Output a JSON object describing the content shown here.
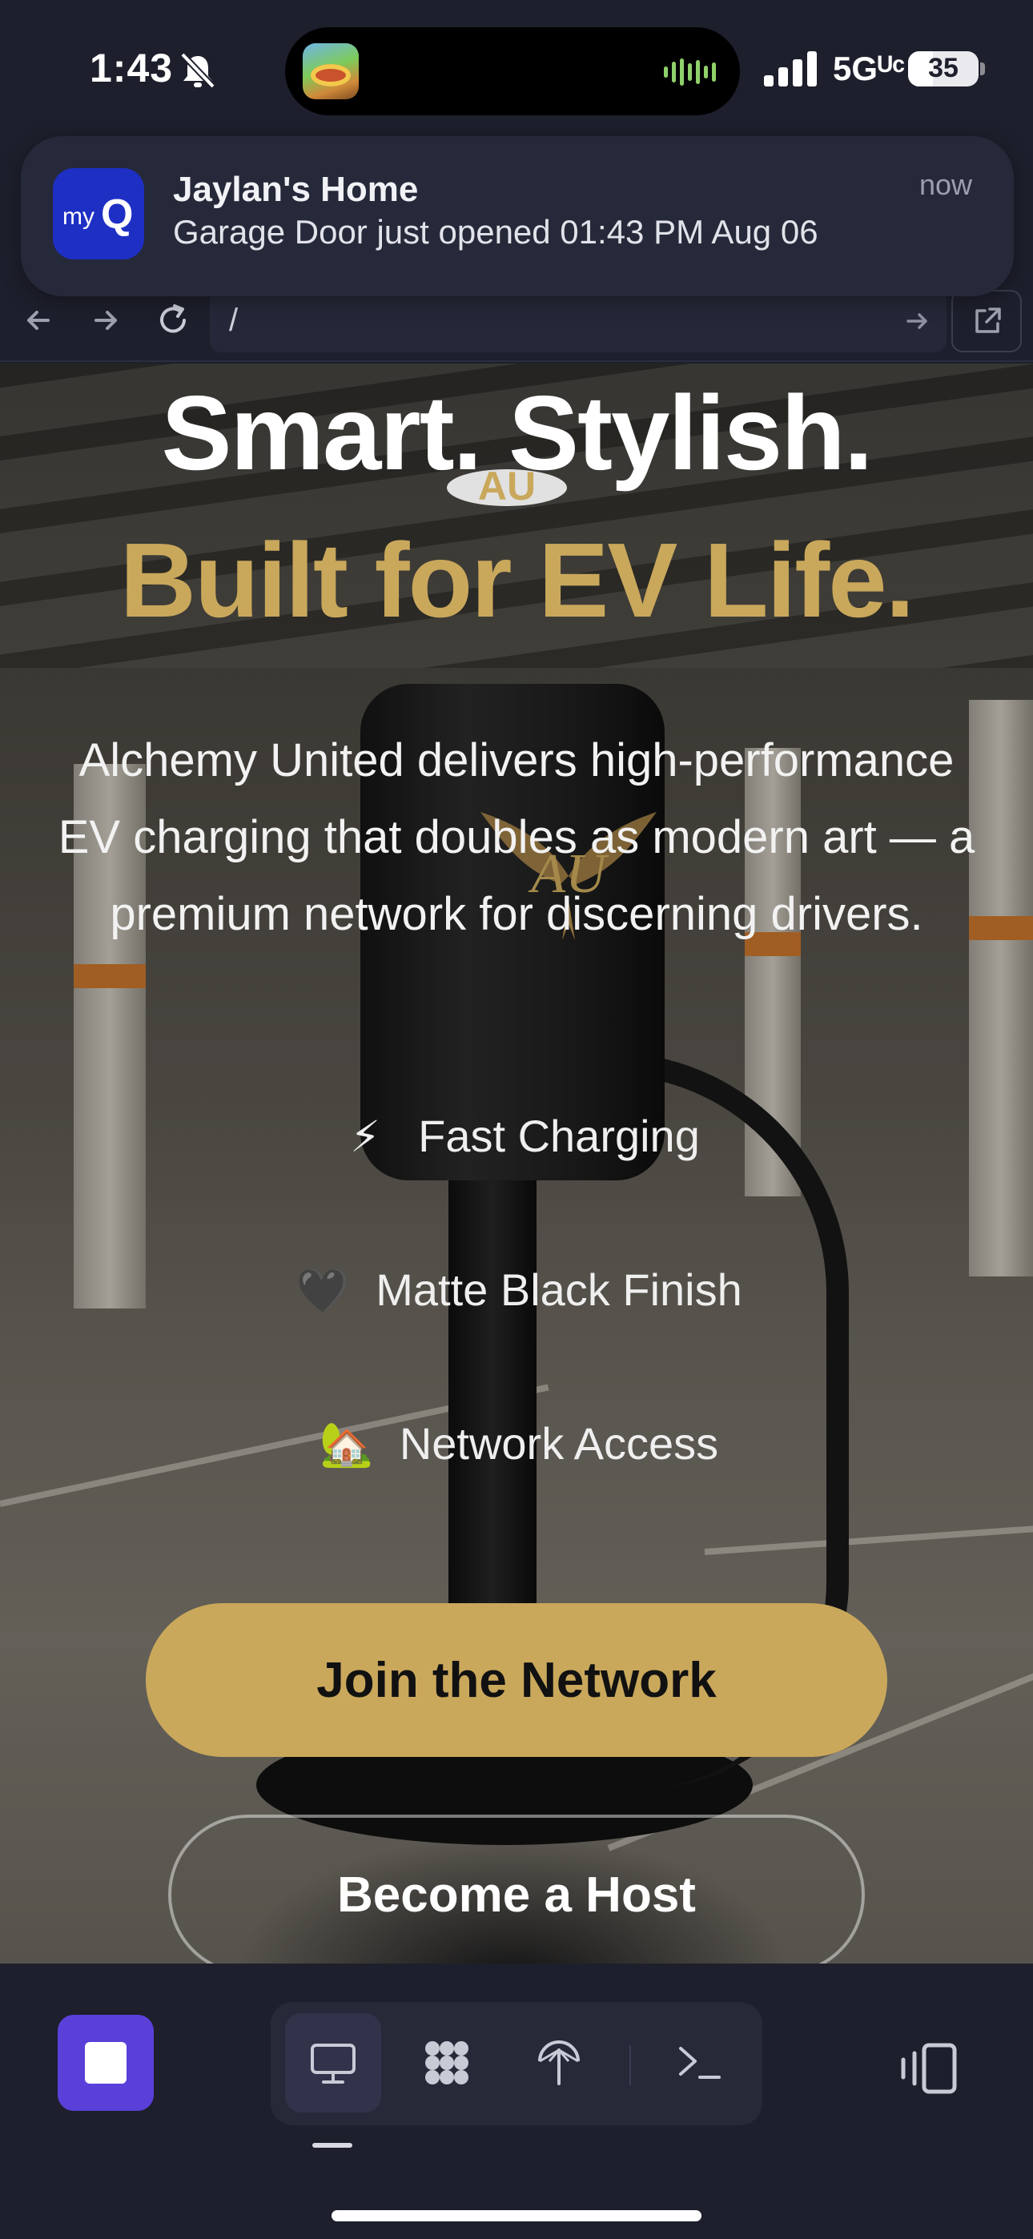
{
  "status_bar": {
    "time": "1:43",
    "network": "5Gᵁᶜ",
    "battery": "35",
    "battery_level": 0.35
  },
  "notification": {
    "app_icon_my": "my",
    "app_icon_q": "Q",
    "title": "Jaylan's Home",
    "body": "Garage Door just opened 01:43 PM Aug 06",
    "time": "now"
  },
  "browser": {
    "url": "/"
  },
  "hero": {
    "title_line1": "Smart. Stylish.",
    "badge": "AU",
    "title_line2": "Built for EV Life.",
    "description": "Alchemy United delivers high-performance EV charging that doubles as modern art — a premium network for discerning drivers.",
    "features": [
      {
        "emoji": "⚡",
        "icon": "lightning-icon",
        "label": "Fast Charging"
      },
      {
        "emoji": "🖤",
        "icon": "black-heart-icon",
        "label": "Matte Black Finish"
      },
      {
        "emoji": "🏡",
        "icon": "house-icon",
        "label": "Network Access"
      }
    ],
    "primary_button": "Join the Network",
    "secondary_button": "Become a Host"
  },
  "colors": {
    "accent_gold": "#c9a85c",
    "background": "#1d1f2c",
    "stop_button": "#5a40d8",
    "notification_icon": "#1e2fc4"
  },
  "toolbar": {
    "icons": [
      "stop-icon",
      "desktop-icon",
      "apps-grid-icon",
      "network-icon",
      "terminal-icon",
      "device-switch-icon"
    ]
  }
}
